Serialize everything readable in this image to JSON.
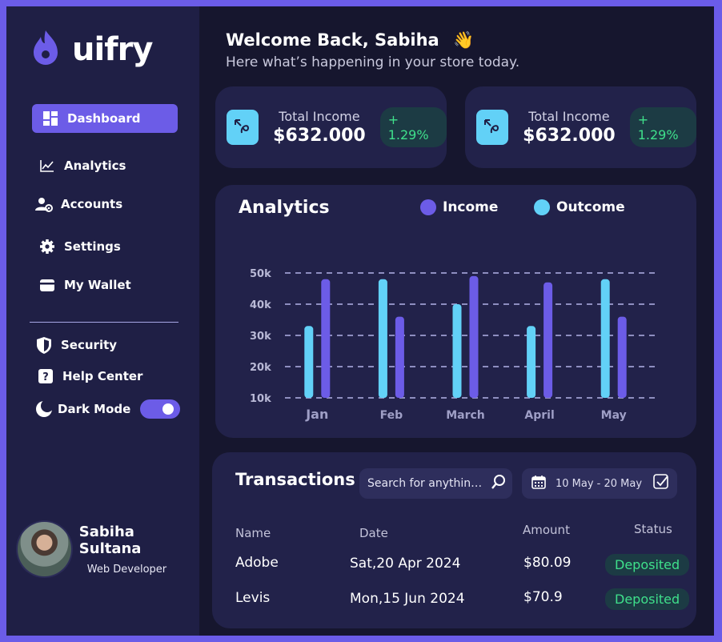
{
  "brand": {
    "name": "uifry"
  },
  "sidebar": {
    "items": [
      {
        "label": "Dashboard",
        "icon": "dashboard-icon"
      },
      {
        "label": "Analytics",
        "icon": "chart-line-icon"
      },
      {
        "label": "Accounts",
        "icon": "accounts-icon"
      },
      {
        "label": "Settings",
        "icon": "gear-icon"
      },
      {
        "label": "My Wallet",
        "icon": "wallet-icon"
      },
      {
        "label": "Security",
        "icon": "shield-icon"
      },
      {
        "label": "Help Center",
        "icon": "help-icon"
      },
      {
        "label": "Dark Mode",
        "icon": "moon-icon"
      }
    ],
    "dark_mode_on": true
  },
  "profile": {
    "name": "Sabiha Sultana",
    "role": "Web Developer"
  },
  "header": {
    "welcome": "Welcome Back, Sabiha",
    "wave": "👋",
    "subtitle": "Here what’s happening in your store today."
  },
  "income_cards": [
    {
      "label": "Total Income",
      "value": "$632.000",
      "change": "+ 1.29%"
    },
    {
      "label": "Total Income",
      "value": "$632.000",
      "change": "+ 1.29%"
    }
  ],
  "analytics": {
    "title": "Analytics",
    "legend": [
      {
        "name": "Income",
        "color": "#6c5ce7"
      },
      {
        "name": "Outcome",
        "color": "#62d1f7"
      }
    ]
  },
  "chart_data": {
    "type": "bar",
    "categories": [
      "Jan",
      "Feb",
      "March",
      "April",
      "May"
    ],
    "series": [
      {
        "name": "Outcome",
        "color": "#62d1f7",
        "values": [
          33,
          48,
          40,
          33,
          48
        ]
      },
      {
        "name": "Income",
        "color": "#6c5ce7",
        "values": [
          48,
          36,
          49,
          47,
          36
        ]
      }
    ],
    "yticks": [
      "10k",
      "20k",
      "30k",
      "40k",
      "50k"
    ],
    "ylim": [
      10,
      50
    ],
    "grid": true,
    "legend_position": "top"
  },
  "transactions": {
    "title": "Transactions",
    "search_placeholder": "Search for anything...",
    "date_range": "10 May - 20 May",
    "columns": [
      "Name",
      "Date",
      "Amount",
      "Status"
    ],
    "rows": [
      {
        "name": "Adobe",
        "date": "Sat,20 Apr  2024",
        "amount": "$80.09",
        "status": "Deposited"
      },
      {
        "name": "Levis",
        "date": "Mon,15 Jun 2024",
        "amount": "$70.9",
        "status": "Deposited"
      }
    ]
  }
}
